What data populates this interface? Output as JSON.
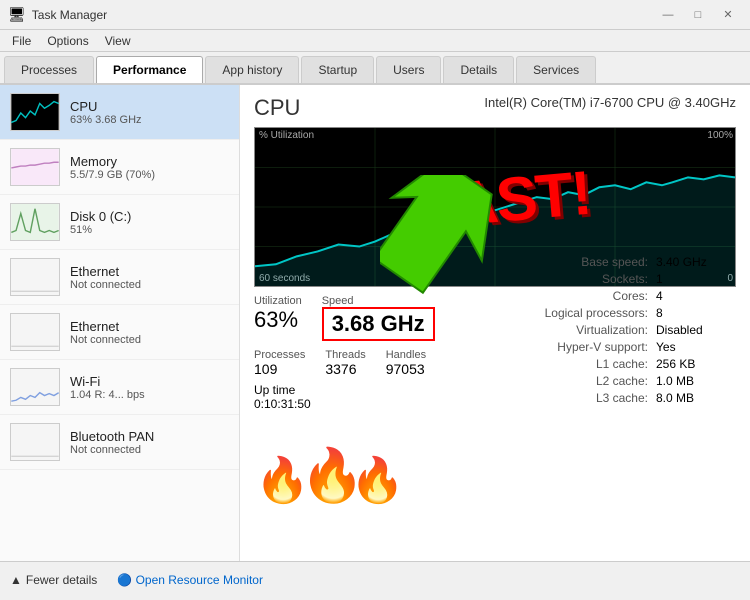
{
  "titleBar": {
    "icon": "⊞",
    "title": "Task Manager",
    "minimizeLabel": "—",
    "maximizeLabel": "□",
    "closeLabel": "✕"
  },
  "menuBar": {
    "items": [
      "File",
      "Options",
      "View"
    ]
  },
  "tabs": [
    {
      "id": "processes",
      "label": "Processes",
      "active": false
    },
    {
      "id": "performance",
      "label": "Performance",
      "active": true
    },
    {
      "id": "apphistory",
      "label": "App history",
      "active": false
    },
    {
      "id": "startup",
      "label": "Startup",
      "active": false
    },
    {
      "id": "users",
      "label": "Users",
      "active": false
    },
    {
      "id": "details",
      "label": "Details",
      "active": false
    },
    {
      "id": "services",
      "label": "Services",
      "active": false
    }
  ],
  "sidebar": {
    "items": [
      {
        "id": "cpu",
        "name": "CPU",
        "sub": "63% 3.68 GHz",
        "active": true,
        "type": "cpu"
      },
      {
        "id": "memory",
        "name": "Memory",
        "sub": "5.5/7.9 GB (70%)",
        "active": false,
        "type": "memory"
      },
      {
        "id": "disk0",
        "name": "Disk 0 (C:)",
        "sub": "51%",
        "active": false,
        "type": "disk"
      },
      {
        "id": "ethernet1",
        "name": "Ethernet",
        "sub": "Not connected",
        "active": false,
        "type": "ethernet"
      },
      {
        "id": "ethernet2",
        "name": "Ethernet",
        "sub": "Not connected",
        "active": false,
        "type": "ethernet"
      },
      {
        "id": "wifi",
        "name": "Wi-Fi",
        "sub": "1.04 R: 4... bps",
        "active": false,
        "type": "wifi"
      },
      {
        "id": "btpan",
        "name": "Bluetooth PAN",
        "sub": "Not connected",
        "active": false,
        "type": "ethernet"
      }
    ]
  },
  "mainPanel": {
    "cpuTitle": "CPU",
    "cpuModel": "Intel(R) Core(TM) i7-6700 CPU @ 3.40GHz",
    "chartLabel": "% Utilization",
    "chartMax": "100%",
    "chartMin": "0",
    "chartTime": "60 seconds",
    "utilizationLabel": "Utilization",
    "utilizationValue": "63%",
    "speedLabel": "Speed",
    "speedValue": "3.68 GHz",
    "processesLabel": "Processes",
    "processesValue": "109",
    "threadsLabel": "Threads",
    "threadsValue": "3376",
    "handlesLabel": "Handles",
    "handlesValue": "97053",
    "uptimeLabel": "Up time",
    "uptimeValue": "0:10:31:50",
    "fastText": "FAST!",
    "infoPanel": {
      "rows": [
        {
          "key": "Base speed:",
          "value": "3.40 GHz"
        },
        {
          "key": "Sockets:",
          "value": "1"
        },
        {
          "key": "Cores:",
          "value": "4"
        },
        {
          "key": "Logical processors:",
          "value": "8"
        },
        {
          "key": "Virtualization:",
          "value": "Disabled"
        },
        {
          "key": "Hyper-V support:",
          "value": "Yes"
        },
        {
          "key": "L1 cache:",
          "value": "256 KB"
        },
        {
          "key": "L2 cache:",
          "value": "1.0 MB"
        },
        {
          "key": "L3 cache:",
          "value": "8.0 MB"
        }
      ]
    }
  },
  "bottomBar": {
    "fewerDetailsLabel": "Fewer details",
    "openResourceLabel": "Open Resource Monitor"
  }
}
